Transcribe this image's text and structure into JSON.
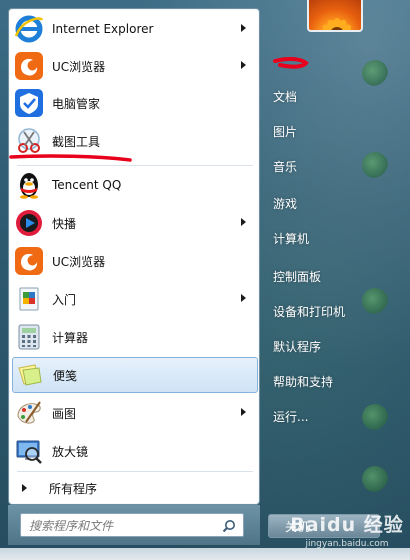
{
  "start_menu": {
    "programs": [
      {
        "label": "Internet Explorer",
        "icon": "internet-explorer-icon",
        "has_submenu": true
      },
      {
        "label": "UC浏览器",
        "icon": "uc-browser-icon",
        "has_submenu": true
      },
      {
        "label": "电脑管家",
        "icon": "pc-manager-icon",
        "has_submenu": false
      },
      {
        "label": "截图工具",
        "icon": "snipping-tool-icon",
        "has_submenu": false
      },
      {
        "label": "Tencent QQ",
        "icon": "qq-penguin-icon",
        "has_submenu": false
      },
      {
        "label": "快播",
        "icon": "qvod-player-icon",
        "has_submenu": true
      },
      {
        "label": "UC浏览器",
        "icon": "uc-browser-icon",
        "has_submenu": false
      },
      {
        "label": "入门",
        "icon": "getting-started-icon",
        "has_submenu": true
      },
      {
        "label": "计算器",
        "icon": "calculator-icon",
        "has_submenu": false
      },
      {
        "label": "便笺",
        "icon": "sticky-notes-icon",
        "has_submenu": false,
        "selected": true
      },
      {
        "label": "画图",
        "icon": "paint-icon",
        "has_submenu": true
      },
      {
        "label": "放大镜",
        "icon": "magnifier-icon",
        "has_submenu": false
      }
    ],
    "all_programs_label": "所有程序",
    "search": {
      "placeholder": "搜索程序和文件"
    },
    "right_items": [
      {
        "label": "文档"
      },
      {
        "label": "图片"
      },
      {
        "label": "音乐"
      },
      {
        "label": "游戏"
      },
      {
        "label": "计算机"
      },
      {
        "label": "控制面板"
      },
      {
        "label": "设备和打印机"
      },
      {
        "label": "默认程序"
      },
      {
        "label": "帮助和支持"
      },
      {
        "label": "运行..."
      }
    ],
    "shutdown_label": "关机"
  },
  "watermark": {
    "brand": "Baidu 经验",
    "url": "jingyan.baidu.com"
  },
  "colors": {
    "annotation_red": "#e8001c",
    "selected_highlight": "#cfe3f6",
    "taskbar_blue": "#2f5c73"
  }
}
